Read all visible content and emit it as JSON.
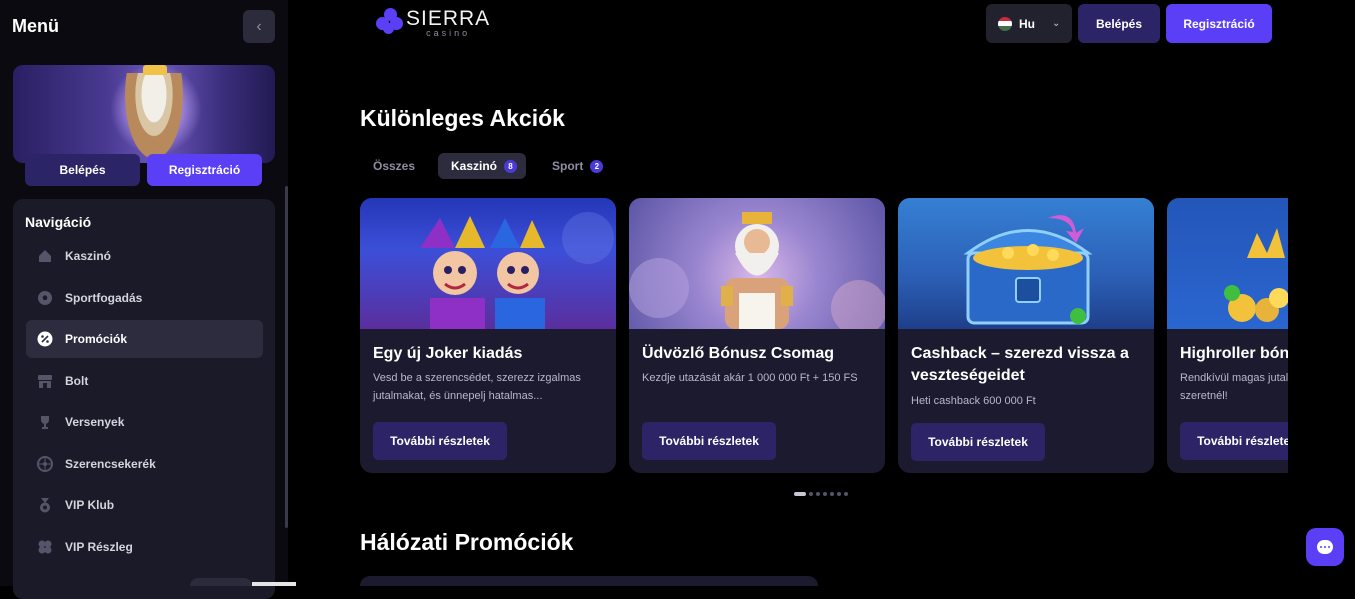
{
  "sidebar": {
    "title": "Menü",
    "login_label": "Belépés",
    "register_label": "Regisztráció",
    "nav_title": "Navigáció",
    "items": [
      {
        "label": "Kaszinó",
        "icon": "home-icon"
      },
      {
        "label": "Sportfogadás",
        "icon": "soccer-ball-icon"
      },
      {
        "label": "Promóciók",
        "icon": "percent-badge-icon",
        "active": true
      },
      {
        "label": "Bolt",
        "icon": "shop-icon"
      },
      {
        "label": "Versenyek",
        "icon": "trophy-icon"
      },
      {
        "label": "Szerencsekerék",
        "icon": "wheel-icon"
      },
      {
        "label": "VIP Klub",
        "icon": "medal-icon"
      },
      {
        "label": "VIP Részleg",
        "icon": "clover-icon"
      }
    ]
  },
  "header": {
    "logo_main": "SIERRA",
    "logo_sub": "casino",
    "language": "Hu",
    "login_label": "Belépés",
    "register_label": "Regisztráció"
  },
  "special": {
    "title": "Különleges Akciók",
    "tabs": [
      {
        "label": "Összes"
      },
      {
        "label": "Kaszinó",
        "count": "8",
        "active": true
      },
      {
        "label": "Sport",
        "count": "2"
      }
    ],
    "cards": [
      {
        "title": "Egy új Joker kiadás",
        "desc": "Vesd be a szerencsédet, szerezz izgalmas jutalmakat, és ünnepelj hatalmas...",
        "button": "További részletek"
      },
      {
        "title": "Üdvözlő Bónusz Csomag",
        "desc": "Kezdje utazását akár 1 000 000 Ft + 150 FS",
        "button": "További részletek"
      },
      {
        "title": "Cashback – szerezd vissza a veszteségeidet",
        "desc": "Heti cashback 600 000 Ft",
        "button": "További részletek"
      },
      {
        "title": "Highroller bónusz",
        "desc": "Rendkívül magas jutalmak, ha nagyban szeretnél!",
        "button": "További részletek"
      }
    ]
  },
  "network": {
    "title": "Hálózati Promóciók"
  },
  "colors": {
    "accent": "#5b3ff6",
    "dark_button": "#2b2466",
    "card_bg": "#1c1a2e"
  }
}
